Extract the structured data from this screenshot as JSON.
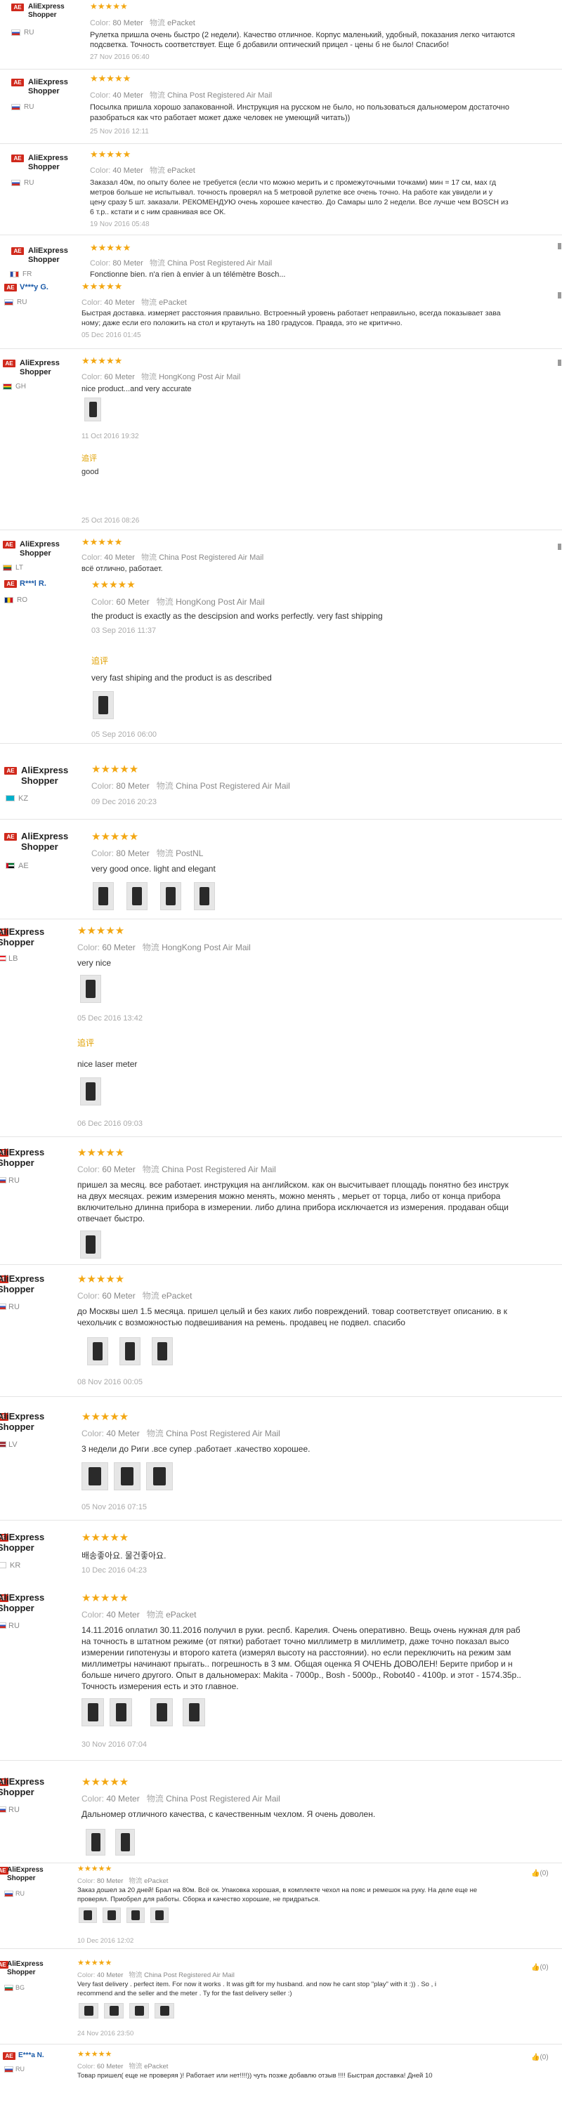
{
  "reviews": [
    {
      "user": "AliExpress Shopper",
      "country": "RU",
      "stars": "★★★★★",
      "color_label": "Color:",
      "color": "80 Meter",
      "ship_label": "物流",
      "ship": "ePacket",
      "text": "Рулетка пришла очень быстро (2 недели). Качество отличное. Корпус маленький, удобный, показания легко читаются",
      "text2": "подсветка. Точность соответствует. Еще б добавили оптический прицел - цены б не было! Спасибо!",
      "date": "27 Nov 2016 06:40"
    },
    {
      "user": "AliExpress Shopper",
      "country": "RU",
      "stars": "★★★★★",
      "color_label": "Color:",
      "color": "40 Meter",
      "ship_label": "物流",
      "ship": "China Post Registered Air Mail",
      "text": "Посылка пришла хорошо запакованной. Инструкция на русском не было, но пользоваться дальномером достаточно",
      "text2": "разобраться как что работает может даже человек не умеющий читать))",
      "date": "25 Nov 2016 12:11"
    },
    {
      "user": "AliExpress Shopper",
      "country": "RU",
      "stars": "★★★★★",
      "color_label": "Color:",
      "color": "40 Meter",
      "ship_label": "物流",
      "ship": "ePacket",
      "text": "Заказал 40м, по опыту более не требуется (если что можно мерить и с промежуточными точками) мин = 17 см, мах гд",
      "text2": "метров больше не испытывал. точность проверял на 5 метровой рулетке все очень точно. На работе как увидели и у",
      "text3": "цену сразу 5 шт. заказали. РЕКОМЕНДУЮ очень хорошее качество. До Самары шло 2 недели. Все лучше чем BOSCH из",
      "text4": "6 т.р.. кстати и с ним сравнивая все ОК.",
      "date": "19 Nov 2016 05:48"
    },
    {
      "user": "AliExpress Shopper",
      "country": "FR",
      "stars": "★★★★★",
      "color_label": "Color:",
      "color": "80 Meter",
      "ship_label": "物流",
      "ship": "China Post Registered Air Mail",
      "text": "Fonctionne bien. n'a rien à envier à un télémètre Bosch..."
    },
    {
      "user": "V***y G.",
      "country": "RU",
      "stars": "★★★★★",
      "color_label": "Color:",
      "color": "40 Meter",
      "ship_label": "物流",
      "ship": "ePacket",
      "text": "Быстрая доставка. измеряет расстояния правильно. Встроенный уровень работает неправильно, всегда показывает зава",
      "text2": "ному; даже если его положить на стол и крутануть на 180 градусов. Правда, это не критично.",
      "date": "05 Dec 2016 01:45"
    },
    {
      "user": "AliExpress Shopper",
      "country": "GH",
      "stars": "★★★★★",
      "color_label": "Color:",
      "color": "60 Meter",
      "ship_label": "物流",
      "ship": "HongKong Post Air Mail",
      "text": "nice product...and very accurate",
      "date": "11 Oct 2016 19:32",
      "add_label": "追评",
      "add_text": "good",
      "add_date": "25 Oct 2016 08:26"
    },
    {
      "user": "AliExpress Shopper",
      "country": "LT",
      "stars": "★★★★★",
      "color_label": "Color:",
      "color": "40 Meter",
      "ship_label": "物流",
      "ship": "China Post Registered Air Mail",
      "text": "всё отлично, работает."
    },
    {
      "user": "R***l R.",
      "country": "RO",
      "stars": "★★★★★",
      "color_label": "Color:",
      "color": "60 Meter",
      "ship_label": "物流",
      "ship": "HongKong Post Air Mail",
      "text": "the product is exactly as the descipsion and works perfectly. very fast shipping",
      "date": "03 Sep 2016 11:37",
      "add_label": "追评",
      "add_text": "very fast shiping and the product is as described",
      "add_date": "05 Sep 2016 06:00"
    },
    {
      "user": "AliExpress Shopper",
      "country": "KZ",
      "stars": "★★★★★",
      "color_label": "Color:",
      "color": "80 Meter",
      "ship_label": "物流",
      "ship": "China Post Registered Air Mail",
      "date": "09 Dec 2016 20:23"
    },
    {
      "user": "AliExpress Shopper",
      "country": "AE",
      "stars": "★★★★★",
      "color_label": "Color:",
      "color": "80 Meter",
      "ship_label": "物流",
      "ship": "PostNL",
      "text": "very good once. light and elegant"
    },
    {
      "user": "AliExpress Shopper",
      "country": "LB",
      "stars": "★★★★★",
      "color_label": "Color:",
      "color": "60 Meter",
      "ship_label": "物流",
      "ship": "HongKong Post Air Mail",
      "text": "very nice",
      "date": "05 Dec 2016 13:42",
      "add_label": "追评",
      "add_text": "nice laser meter",
      "add_date": "06 Dec 2016 09:03"
    },
    {
      "user": "AliExpress Shopper",
      "country": "RU",
      "stars": "★★★★★",
      "color_label": "Color:",
      "color": "60 Meter",
      "ship_label": "物流",
      "ship": "China Post Registered Air Mail",
      "text": "пришел за месяц. все работает. инструкция на английском. как он высчитывает площадь понятно без инструк",
      "text2": "на двух месяцах. режим измерения можно менять, можно менять , мерьет от торца, либо от конца прибора",
      "text3": "включительно длинна прибора в измерении. либо длина прибора исключается из измерения. продаван общи",
      "text4": "отвечает быстро."
    },
    {
      "user": "AliExpress Shopper",
      "country": "RU",
      "stars": "★★★★★",
      "color_label": "Color:",
      "color": "60 Meter",
      "ship_label": "物流",
      "ship": "ePacket",
      "text": "до Москвы шел 1.5 месяца. пришел целый и без каких либо повреждений. товар соответствует описанию. в к",
      "text2": "чехольчик с возможностью подвешивания на ремень. продавец не подвел. спасибо",
      "date": "08 Nov 2016 00:05"
    },
    {
      "user": "AliExpress Shopper",
      "country": "LV",
      "stars": "★★★★★",
      "color_label": "Color:",
      "color": "40 Meter",
      "ship_label": "物流",
      "ship": "China Post Registered Air Mail",
      "text": "3 недели до Риги .все супер .работает .качество хорошее.",
      "date": "05 Nov 2016 07:15"
    },
    {
      "user": "AliExpress Shopper",
      "country": "KR",
      "stars": "★★★★★",
      "text": "배송좋아요. 물건좋아요.",
      "date": "10 Dec 2016 04:23"
    },
    {
      "user": "AliExpress Shopper",
      "country": "RU",
      "stars": "★★★★★",
      "color_label": "Color:",
      "color": "40 Meter",
      "ship_label": "物流",
      "ship": "ePacket",
      "text": "14.11.2016 оплатил 30.11.2016 получил в руки. респб. Карелия. Очень оперативно. Вещь очень нужная для раб",
      "text2": "на точность в штатном режиме (от пятки) работает точно миллиметр в миллиметр, даже точно показал высо",
      "text3": "измерении гипотенузы и второго катета (измерял высоту на расстоянии). но если переключить на режим зам",
      "text4": "миллиметры начинают прыгать.. погрешность в 3 мм. Общая оценка Я ОЧЕНЬ ДОВОЛЕН! Берите прибор и н",
      "text5": "больше ничего другого. Опыт в дальномерах: Makita - 7000р., Bosh - 5000р., Robot40 - 4100р. и этот - 1574.35р..",
      "text6": "Точность измерения есть и это главное.",
      "date": "30 Nov 2016 07:04"
    },
    {
      "user": "AliExpress Shopper",
      "country": "RU",
      "stars": "★★★★★",
      "color_label": "Color:",
      "color": "40 Meter",
      "ship_label": "物流",
      "ship": "China Post Registered Air Mail",
      "text": "Дальномер отличного качества, с качественным чехлом. Я очень доволен."
    },
    {
      "user": "AliExpress Shopper",
      "country": "RU",
      "stars": "★★★★★",
      "color_label": "Color:",
      "color": "80 Meter",
      "ship_label": "物流",
      "ship": "ePacket",
      "text": "Заказ дошел за 20 дней! Брал на 80м. Всё ок. Упаковка хорошая, в комплекте чехол на пояс и ремешок на руку. На деле еще не",
      "text2": "проверял. Приобрел для работы. Сборка и качество хорошие, не придраться.",
      "date": "10 Dec 2016 12:02",
      "helpful": "(0)"
    },
    {
      "user": "AliExpress Shopper",
      "country": "BG",
      "stars": "★★★★★",
      "color_label": "Color:",
      "color": "40 Meter",
      "ship_label": "物流",
      "ship": "China Post Registered Air Mail",
      "text": "Very fast delivery . perfect item. For now it works . It was gift for my husband. and now he cant stop \"play\" with it :)) . So , i",
      "text2": "recommend and the seller and the meter . Ty for the fast delivery seller :)",
      "date": "24 Nov 2016 23:50",
      "helpful": "(0)"
    },
    {
      "user": "E***a N.",
      "country": "RU",
      "stars": "★★★★★",
      "color_label": "Color:",
      "color": "60 Meter",
      "ship_label": "物流",
      "ship": "ePacket",
      "text": "Товар пришел( еще не проверяя )! Работает или нет!!!!)) чуть позже добавлю отзыв !!!! Быстрая доставка! Дней 10",
      "helpful": "(0)"
    }
  ],
  "colors": {
    "accent": "#d0291c",
    "stars": "#f3a712",
    "followup": "#e0a000"
  }
}
